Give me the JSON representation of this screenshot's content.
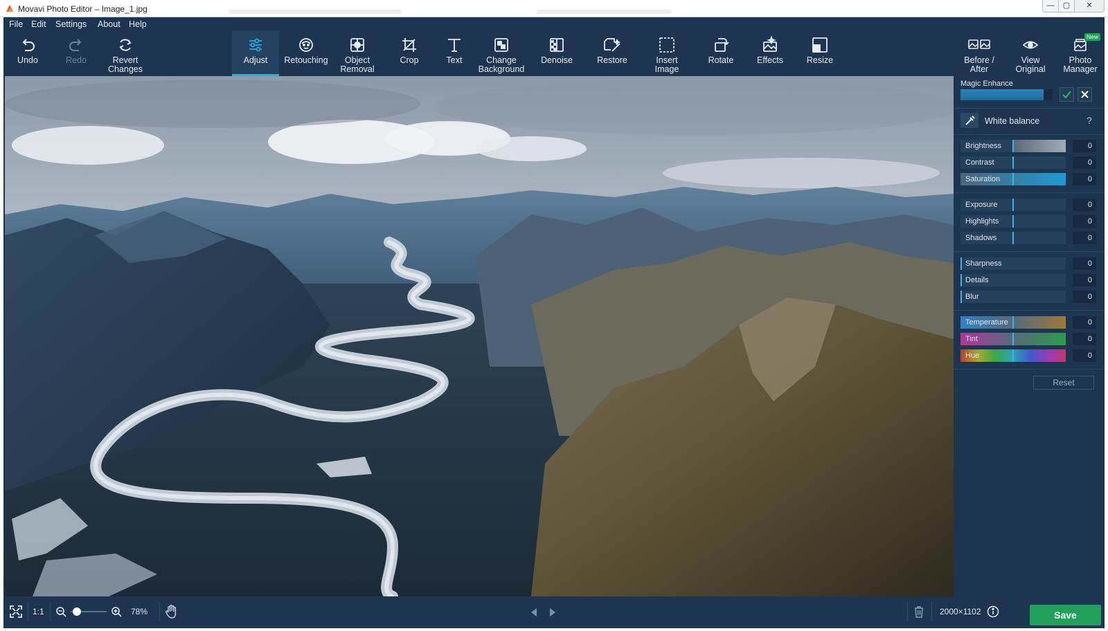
{
  "window": {
    "title": "Movavi Photo Editor – Image_1.jpg",
    "controls": {
      "minimize": "—",
      "maximize": "▢",
      "close": "✕"
    }
  },
  "menu": [
    "File",
    "Edit",
    "Settings",
    "About",
    "Help"
  ],
  "toolbar": {
    "history": [
      {
        "label": "Undo",
        "icon": "undo-icon",
        "enabled": true
      },
      {
        "label": "Redo",
        "icon": "redo-icon",
        "enabled": false
      },
      {
        "label_line1": "Revert",
        "label_line2": "Changes",
        "icon": "revert-icon",
        "enabled": true
      }
    ],
    "tools": [
      {
        "label": "Adjust",
        "icon": "sliders-icon",
        "active": true
      },
      {
        "label": "Retouching",
        "icon": "face-icon"
      },
      {
        "label_line1": "Object",
        "label_line2": "Removal",
        "icon": "object-removal-icon"
      },
      {
        "label": "Crop",
        "icon": "crop-icon"
      },
      {
        "label": "Text",
        "icon": "text-icon"
      },
      {
        "label_line1": "Change",
        "label_line2": "Background",
        "icon": "background-icon"
      },
      {
        "label": "Denoise",
        "icon": "denoise-icon"
      },
      {
        "label": "Restore",
        "icon": "restore-icon"
      },
      {
        "label_line1": "Insert",
        "label_line2": "Image",
        "icon": "insert-image-icon"
      },
      {
        "label": "Rotate",
        "icon": "rotate-icon"
      },
      {
        "label": "Effects",
        "icon": "effects-icon"
      },
      {
        "label": "Resize",
        "icon": "resize-icon"
      }
    ],
    "right": [
      {
        "label_line1": "Before /",
        "label_line2": "After",
        "icon": "before-after-icon"
      },
      {
        "label_line1": "View",
        "label_line2": "Original",
        "icon": "eye-icon"
      },
      {
        "label_line1": "Photo",
        "label_line2": "Manager",
        "icon": "photo-manager-icon",
        "badge": "New"
      }
    ]
  },
  "panel": {
    "magic_enhance": {
      "label": "Magic Enhance",
      "progress": 0.9
    },
    "white_balance": {
      "label": "White balance",
      "help": "?"
    },
    "groups": [
      [
        {
          "name": "Brightness",
          "value": "0"
        },
        {
          "name": "Contrast",
          "value": "0"
        },
        {
          "name": "Saturation",
          "value": "0"
        }
      ],
      [
        {
          "name": "Exposure",
          "value": "0"
        },
        {
          "name": "Highlights",
          "value": "0"
        },
        {
          "name": "Shadows",
          "value": "0"
        }
      ],
      [
        {
          "name": "Sharpness",
          "value": "0"
        },
        {
          "name": "Details",
          "value": "0"
        },
        {
          "name": "Blur",
          "value": "0"
        }
      ],
      [
        {
          "name": "Temperature",
          "value": "0"
        },
        {
          "name": "Tint",
          "value": "0"
        },
        {
          "name": "Hue",
          "value": "0"
        }
      ]
    ],
    "reset_label": "Reset"
  },
  "statusbar": {
    "ratio": "1:1",
    "zoom": "78%",
    "zoom_level": 0.05,
    "dimensions": "2000×1102",
    "save_label": "Save"
  },
  "colors": {
    "accent": "#2aa8e0",
    "save": "#1fa15a",
    "background": "#1d3550"
  }
}
